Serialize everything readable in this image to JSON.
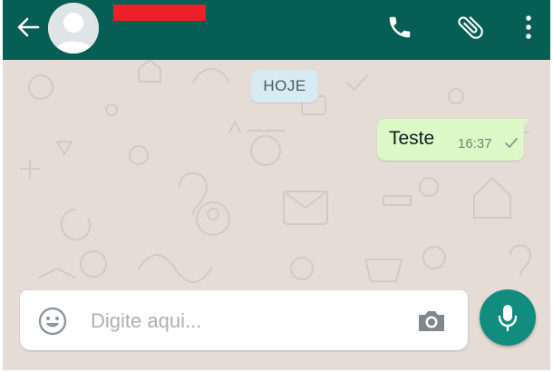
{
  "header": {
    "contact_name": "",
    "back_icon": "arrow-left-icon",
    "avatar_icon": "default-avatar-icon",
    "call_icon": "phone-icon",
    "attach_icon": "paperclip-icon",
    "menu_icon": "more-vertical-icon",
    "color": "#075e54"
  },
  "chat": {
    "date_label": "HOJE",
    "wallpaper_color": "#e5ddd5",
    "messages": [
      {
        "direction": "outgoing",
        "text": "Teste",
        "time": "16:37",
        "status_icon": "single-check-icon",
        "bubble_color": "#dcf8c6"
      }
    ]
  },
  "composer": {
    "placeholder": "Digite aqui...",
    "value": "",
    "emoji_icon": "emoji-icon",
    "camera_icon": "camera-icon",
    "mic_icon": "microphone-icon",
    "send_color": "#128c7e"
  }
}
